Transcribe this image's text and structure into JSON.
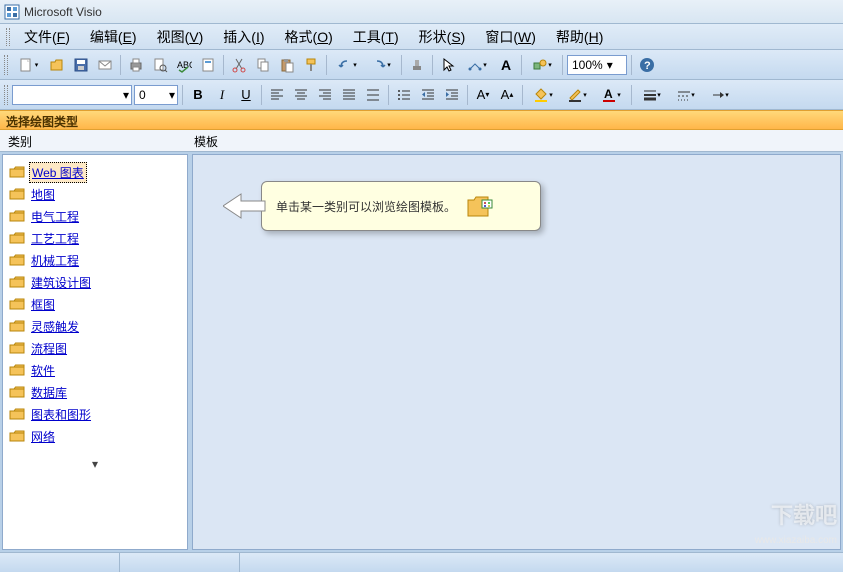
{
  "app": {
    "title": "Microsoft Visio"
  },
  "menus": [
    {
      "label": "文件",
      "key": "F"
    },
    {
      "label": "编辑",
      "key": "E"
    },
    {
      "label": "视图",
      "key": "V"
    },
    {
      "label": "插入",
      "key": "I"
    },
    {
      "label": "格式",
      "key": "O"
    },
    {
      "label": "工具",
      "key": "T"
    },
    {
      "label": "形状",
      "key": "S"
    },
    {
      "label": "窗口",
      "key": "W"
    },
    {
      "label": "帮助",
      "key": "H"
    }
  ],
  "toolbar1": {
    "zoom": "100%"
  },
  "toolbar2": {
    "font": "",
    "size": "0"
  },
  "banner": "选择绘图类型",
  "headers": {
    "categories": "类别",
    "templates": "模板"
  },
  "categories": [
    {
      "label": "Web 图表",
      "selected": true
    },
    {
      "label": "地图"
    },
    {
      "label": "电气工程"
    },
    {
      "label": "工艺工程"
    },
    {
      "label": "机械工程"
    },
    {
      "label": "建筑设计图"
    },
    {
      "label": "框图"
    },
    {
      "label": "灵感触发"
    },
    {
      "label": "流程图"
    },
    {
      "label": "软件"
    },
    {
      "label": "数据库"
    },
    {
      "label": "图表和图形"
    },
    {
      "label": "网络"
    }
  ],
  "callout": {
    "text": "单击某一类别可以浏览绘图模板。"
  },
  "watermark": {
    "text": "下载吧",
    "url": "www.xiazaiba.com"
  }
}
